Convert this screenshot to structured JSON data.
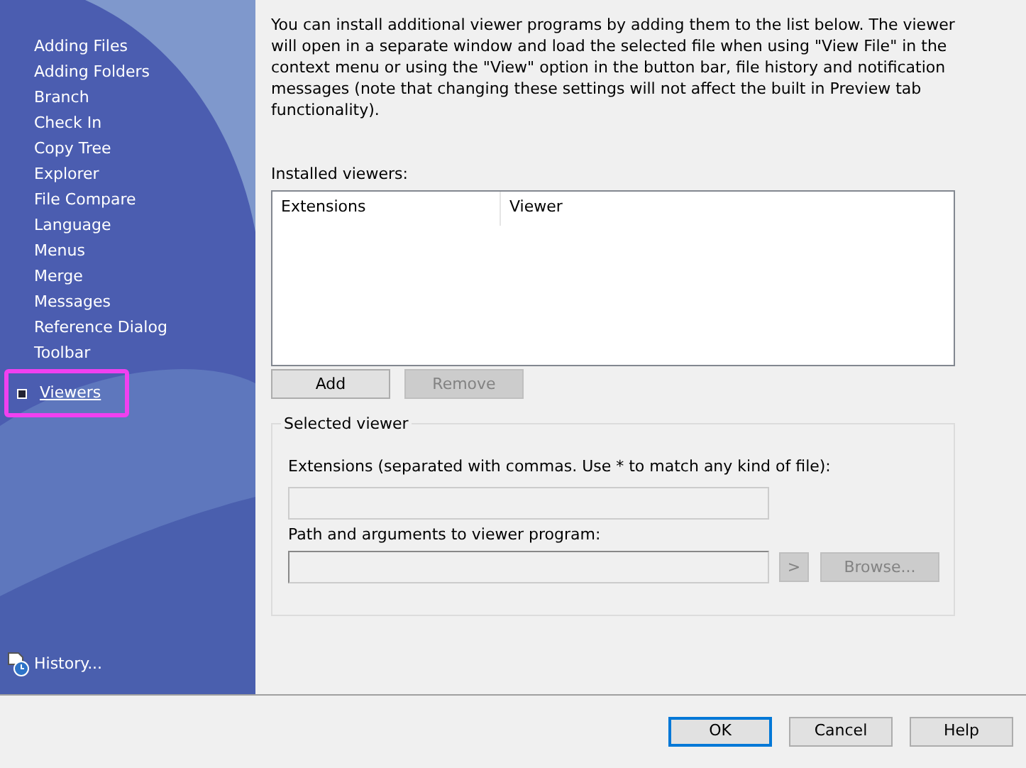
{
  "sidebar": {
    "items": [
      {
        "label": "Adding Files",
        "selected": false
      },
      {
        "label": "Adding Folders",
        "selected": false
      },
      {
        "label": "Branch",
        "selected": false
      },
      {
        "label": "Check In",
        "selected": false
      },
      {
        "label": "Copy Tree",
        "selected": false
      },
      {
        "label": "Explorer",
        "selected": false
      },
      {
        "label": "File Compare",
        "selected": false
      },
      {
        "label": "Language",
        "selected": false
      },
      {
        "label": "Menus",
        "selected": false
      },
      {
        "label": "Merge",
        "selected": false
      },
      {
        "label": "Messages",
        "selected": false
      },
      {
        "label": "Reference Dialog",
        "selected": false
      },
      {
        "label": "Toolbar",
        "selected": false
      },
      {
        "label": "Viewers",
        "selected": true
      }
    ],
    "history_link": "History..."
  },
  "description": "You can install additional viewer programs by adding them to the list below. The viewer will open in a separate window and load the selected file when using \"View File\" in the context menu or using the \"View\" option in the button bar, file history and notification messages (note that changing these settings will not affect the built in Preview tab functionality).",
  "installed_viewers": {
    "label": "Installed viewers:",
    "columns": [
      "Extensions",
      "Viewer"
    ],
    "buttons": [
      {
        "label": "Add",
        "disabled": false
      },
      {
        "label": "Remove",
        "disabled": true
      }
    ]
  },
  "selected_viewer": {
    "title": "Selected viewer",
    "extensions_label": "Extensions (separated with commas. Use * to match any kind of file):",
    "extensions_field": {
      "disabled": true
    },
    "path_label": "Path and arguments to viewer program:",
    "path_field": {
      "disabled": true
    },
    "buttons": [
      {
        "label": ">",
        "disabled": true
      },
      {
        "label": "Browse...",
        "disabled": true
      }
    ]
  },
  "footer_buttons": [
    {
      "label": "OK",
      "default": true
    },
    {
      "label": "Cancel",
      "default": false
    },
    {
      "label": "Help",
      "default": false
    }
  ]
}
